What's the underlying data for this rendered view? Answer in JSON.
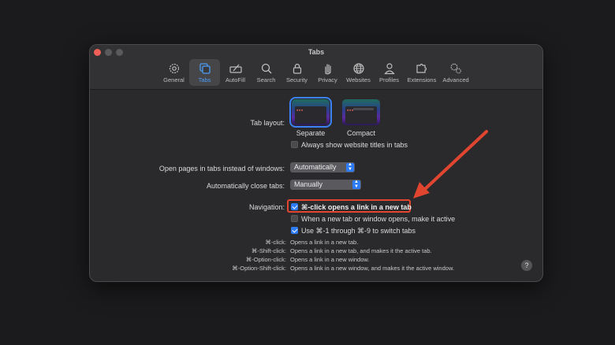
{
  "window": {
    "title": "Tabs"
  },
  "toolbar": {
    "items": [
      {
        "label": "General",
        "icon": "gear-icon"
      },
      {
        "label": "Tabs",
        "icon": "tabs-icon",
        "active": true
      },
      {
        "label": "AutoFill",
        "icon": "autofill-icon"
      },
      {
        "label": "Search",
        "icon": "search-icon"
      },
      {
        "label": "Security",
        "icon": "lock-icon"
      },
      {
        "label": "Privacy",
        "icon": "hand-icon"
      },
      {
        "label": "Websites",
        "icon": "globe-icon"
      },
      {
        "label": "Profiles",
        "icon": "person-icon"
      },
      {
        "label": "Extensions",
        "icon": "puzzle-icon"
      },
      {
        "label": "Advanced",
        "icon": "gears-icon"
      }
    ]
  },
  "tab_layout": {
    "label": "Tab layout:",
    "options": [
      {
        "label": "Separate",
        "selected": true
      },
      {
        "label": "Compact",
        "selected": false
      }
    ],
    "always_show_titles": {
      "label": "Always show website titles in tabs",
      "checked": false
    }
  },
  "open_pages": {
    "label": "Open pages in tabs instead of windows:",
    "value": "Automatically"
  },
  "auto_close": {
    "label": "Automatically close tabs:",
    "value": "Manually"
  },
  "navigation": {
    "label": "Navigation:",
    "options": [
      {
        "label": "⌘-click opens a link in a new tab",
        "checked": true
      },
      {
        "label": "When a new tab or window opens, make it active",
        "checked": false
      },
      {
        "label": "Use ⌘-1 through ⌘-9 to switch tabs",
        "checked": true
      }
    ]
  },
  "legend": [
    {
      "key": "⌘-click:",
      "value": "Opens a link in a new tab."
    },
    {
      "key": "⌘-Shift-click:",
      "value": "Opens a link in a new tab, and makes it the active tab."
    },
    {
      "key": "⌘-Option-click:",
      "value": "Opens a link in a new window."
    },
    {
      "key": "⌘-Option-Shift-click:",
      "value": "Opens a link in a new window, and makes it the active window."
    }
  ],
  "help": {
    "label": "?"
  },
  "colors": {
    "accent": "#2d7cf6",
    "annotation": "#e0452f"
  }
}
